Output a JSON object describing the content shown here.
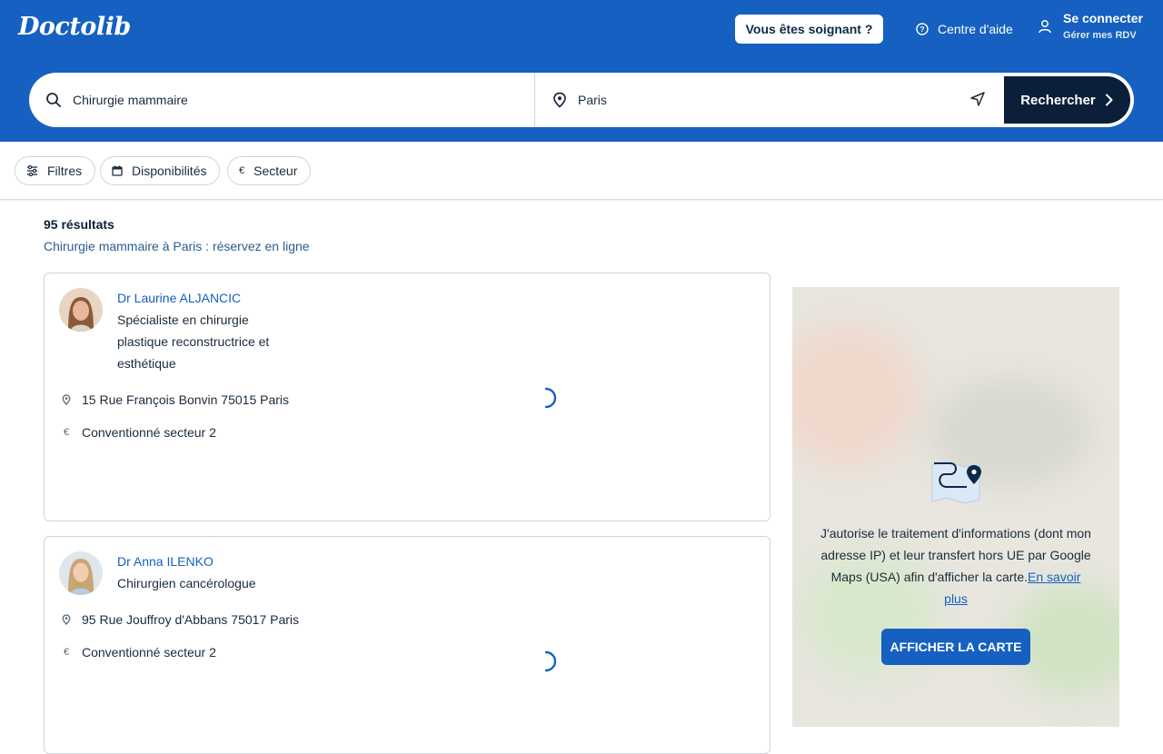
{
  "header": {
    "logo": "Doctolib",
    "pro_button": "Vous êtes soignant ?",
    "help_label": "Centre d'aide",
    "login_title": "Se connecter",
    "login_sub": "Gérer mes RDV"
  },
  "search": {
    "query": "Chirurgie mammaire",
    "location": "Paris",
    "button": "Rechercher"
  },
  "filters": {
    "filters": "Filtres",
    "availability": "Disponibilités",
    "sector": "Secteur"
  },
  "results": {
    "count": "95 résultats",
    "subtitle": "Chirurgie mammaire à Paris : réservez en ligne",
    "doctors": [
      {
        "name": "Dr Laurine ALJANCIC",
        "specialty": "Spécialiste en chirurgie plastique reconstructrice et esthétique",
        "address": "15 Rue François Bonvin 75015 Paris",
        "sector": "Conventionné secteur 2"
      },
      {
        "name": "Dr Anna ILENKO",
        "specialty": "Chirurgien cancérologue",
        "address": "95 Rue Jouffroy d'Abbans 75017 Paris",
        "sector": "Conventionné secteur 2"
      }
    ]
  },
  "map": {
    "consent_text": "J'autorise le traitement d'informations (dont mon adresse IP) et leur transfert hors UE par Google Maps (USA) afin d'afficher la carte.",
    "learn_more": "En savoir plus",
    "show_map_button": "AFFICHER LA CARTE"
  },
  "colors": {
    "brand": "#1560c0",
    "dark": "#0b1f3a"
  }
}
